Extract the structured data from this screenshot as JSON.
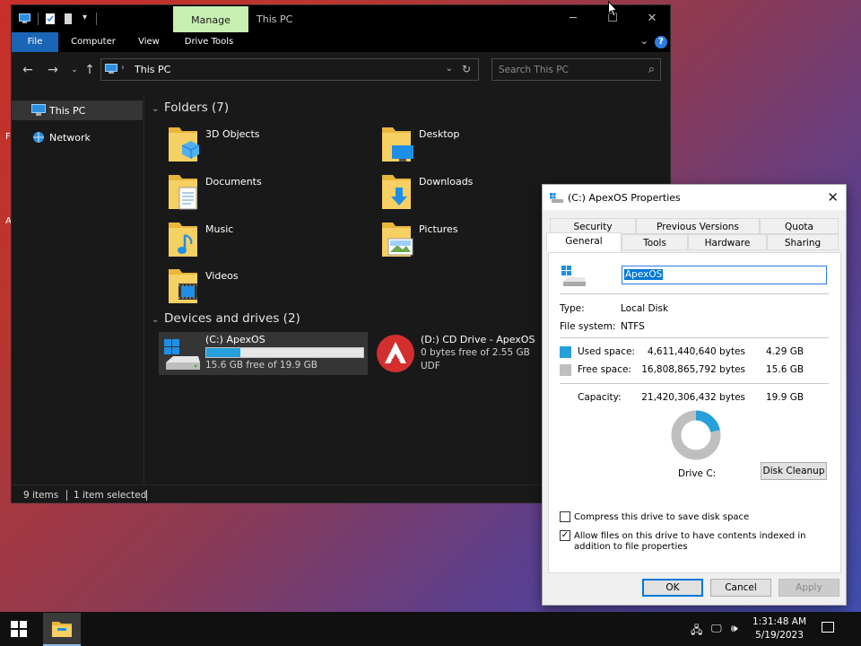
{
  "explorer": {
    "title": "This PC",
    "manage_tab": "Manage",
    "ribbon_tabs": [
      "File",
      "Computer",
      "View",
      "Drive Tools"
    ],
    "address_path": "This PC",
    "search_placeholder": "Search This PC",
    "nav_items": [
      "This PC",
      "Network"
    ],
    "folders_header": "Folders (7)",
    "folders": [
      "3D Objects",
      "Desktop",
      "Documents",
      "Downloads",
      "Music",
      "Pictures",
      "Videos"
    ],
    "devices_header": "Devices and drives (2)",
    "drives": [
      {
        "name": "(C:) ApexOS",
        "free_text": "15.6 GB free of 19.9 GB",
        "used_fraction": 0.216
      },
      {
        "name": "(D:) CD Drive - ApexOS",
        "free_text": "0 bytes free of 2.55 GB",
        "fs": "UDF"
      }
    ],
    "status": {
      "count": "9 items",
      "selected": "1 item selected"
    }
  },
  "properties": {
    "title": "(C:) ApexOS Properties",
    "tabs_row1": [
      "Security",
      "Previous Versions",
      "Quota"
    ],
    "tabs_row2": [
      "General",
      "Tools",
      "Hardware",
      "Sharing"
    ],
    "name_value": "ApexOS",
    "type_label": "Type:",
    "type_value": "Local Disk",
    "fs_label": "File system:",
    "fs_value": "NTFS",
    "used_label": "Used space:",
    "used_bytes": "4,611,440,640 bytes",
    "used_gb": "4.29 GB",
    "free_label": "Free space:",
    "free_bytes": "16,808,865,792 bytes",
    "free_gb": "15.6 GB",
    "capacity_label": "Capacity:",
    "capacity_bytes": "21,420,306,432 bytes",
    "capacity_gb": "19.9 GB",
    "used_fraction": 0.2153,
    "drive_label": "Drive C:",
    "disk_cleanup": "Disk Cleanup",
    "compress_label": "Compress this drive to save disk space",
    "compress_checked": false,
    "index_label": "Allow files on this drive to have contents indexed in addition to file properties",
    "index_checked": true,
    "ok": "OK",
    "cancel": "Cancel",
    "apply": "Apply",
    "colors": {
      "used": "#26a0da",
      "free": "#bfbfbf"
    }
  },
  "taskbar": {
    "time": "1:31:48 AM",
    "date": "5/19/2023"
  }
}
